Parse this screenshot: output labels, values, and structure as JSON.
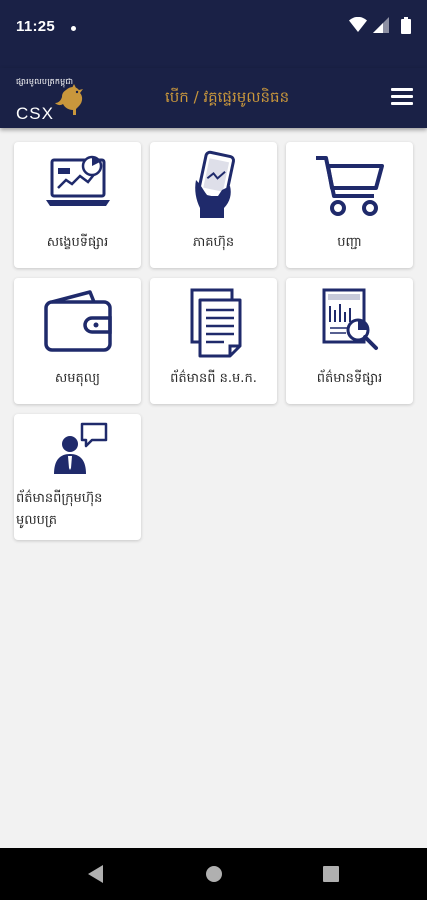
{
  "status_bar": {
    "time": "11:25",
    "icons": [
      "notification-dot",
      "wifi-icon",
      "signal-icon",
      "battery-icon"
    ]
  },
  "header": {
    "logo_tagline": "ផ្សារមូលបត្រកម្ពុជា",
    "logo_text": "CSX",
    "title": "បើក / វគ្គផ្ទេរមូលនិធន",
    "menu_icon": "hamburger-menu-icon"
  },
  "tiles": [
    {
      "label": "សង្ខេបទីផ្សារ",
      "icon": "laptop-chart-icon"
    },
    {
      "label": "ភាគហ៊ុន",
      "icon": "hand-phone-icon"
    },
    {
      "label": "បញ្ជា",
      "icon": "shopping-cart-icon"
    },
    {
      "label": "សមតុល្យ",
      "icon": "wallet-icon"
    },
    {
      "label": "ព័ត៌មានពី ន.ម.ក.",
      "icon": "documents-icon"
    },
    {
      "label": "ព័ត៌មានទីផ្សារ",
      "icon": "report-magnifier-icon"
    },
    {
      "label": "ព័ត៌មានពីក្រុមហ៊ុនមូលបត្រ",
      "icon": "person-speech-icon"
    }
  ],
  "nav_bar": {
    "buttons": [
      "back-icon",
      "home-icon",
      "recents-icon"
    ]
  },
  "colors": {
    "primary_navy": "#1a2146",
    "accent_gold": "#c9973c",
    "icon_navy": "#1f2a6b",
    "background": "#f2f2f2"
  }
}
